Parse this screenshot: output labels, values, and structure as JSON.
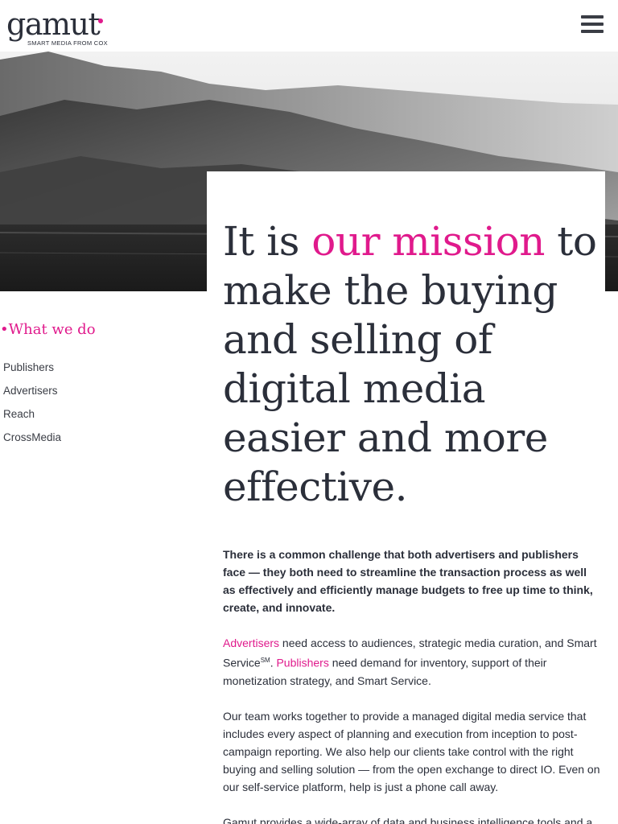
{
  "header": {
    "logo_word": "gamut",
    "logo_tagline": "SMART MEDIA FROM COX",
    "menu_icon": "hamburger-icon"
  },
  "hero": {
    "image": "mountain-landscape-photo"
  },
  "mission": {
    "part1": "It is ",
    "highlight": "our mission",
    "part2": " to make the buying and selling of digital media easier and more effective."
  },
  "side_nav": {
    "title": "What we do",
    "items": [
      {
        "label": "Publishers"
      },
      {
        "label": "Advertisers"
      },
      {
        "label": "Reach"
      },
      {
        "label": "CrossMedia"
      }
    ]
  },
  "content": {
    "lead": "There is a common challenge that both advertisers and publishers face — they both need to streamline the transaction process as well as effectively and efficiently manage budgets to free up time to think, create, and innovate.",
    "p2": {
      "link1": "Advertisers",
      "text1": " need access to audiences, strategic media curation, and Smart Service",
      "sup": "SM",
      "text2": ". ",
      "link2": "Publishers",
      "text3": " need demand for inventory, support of their monetization strategy, and Smart Service."
    },
    "p3": "Our team works together to provide a managed digital media service that includes every aspect of planning and execution from inception to post-campaign reporting. We also help our clients take control with the right buying and selling solution — from the open exchange to direct IO. Even on our self-service platform, help is just a phone call away.",
    "p4": "Gamut provides a wide-array of data and business intelligence tools and a"
  },
  "colors": {
    "accent": "#e01a8c",
    "text": "#2b2f3a"
  }
}
